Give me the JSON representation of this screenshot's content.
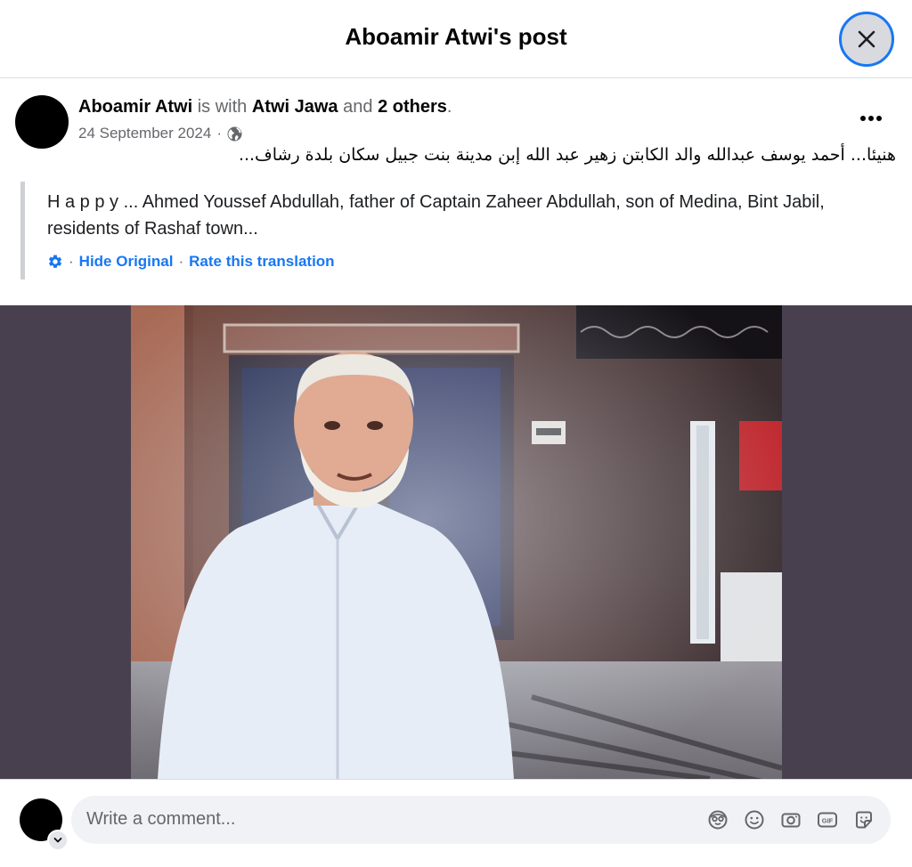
{
  "dialog": {
    "title": "Aboamir Atwi's post"
  },
  "post": {
    "author": "Aboamir Atwi",
    "with_text": "is with",
    "tagged_name": "Atwi Jawa",
    "and_text": "and",
    "others_text": "2 others",
    "period": ".",
    "date": "24 September 2024",
    "separator": "·",
    "privacy_icon": "globe-icon",
    "more_icon": "more-options-icon",
    "arabic_text": "هنيئا... أحمد يوسف عبدالله والد الكابتن زهير عبد الله إبن مدينة بنت جبيل سكان بلدة  رشاف...",
    "translation": {
      "text": "H a p p y ... Ahmed Youssef Abdullah, father of Captain Zaheer Abdullah, son of Medina, Bint Jabil, residents of Rashaf town...",
      "settings_icon": "gear-icon",
      "dot": "·",
      "hide_original": "Hide Original",
      "rate_translation": "Rate this translation"
    }
  },
  "comment_box": {
    "placeholder": "Write a comment...",
    "icons": [
      "avatar-sticker-icon",
      "emoji-icon",
      "camera-icon",
      "gif-icon",
      "sticker-icon"
    ]
  },
  "colors": {
    "accent": "#1877f2",
    "media_background": "#48404f",
    "input_background": "#f0f2f5"
  }
}
